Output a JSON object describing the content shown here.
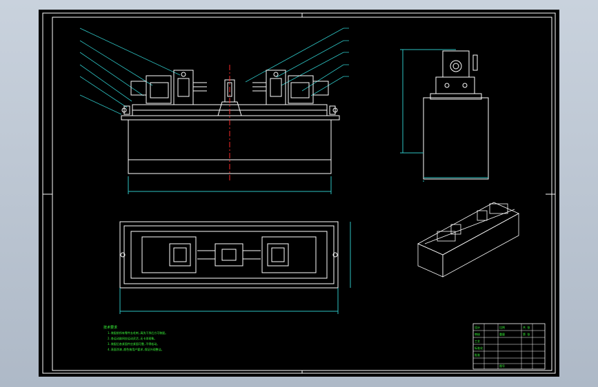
{
  "viewport": {
    "background": "#000000",
    "line_color": "#ffffff",
    "accent_color": "#2ec5c5",
    "center_line_color": "#ff2a2a",
    "text_color": "#3cff3c"
  },
  "technical_requirements": {
    "heading": "技术要求",
    "lines": [
      "1.装配前所有零件去毛刺,清洗干净后方可装配。",
      "2.各运动副间应运动灵活,无卡滞现象。",
      "3.装配后各紧固件应紧固可靠,不得松动。",
      "4.表面涂漆,颜色按用户要求,保证外观整洁。"
    ]
  },
  "title_block": {
    "cells": [
      "设计",
      "审核",
      "工艺",
      "标准化",
      "批准",
      "比例",
      "重量",
      "共 张",
      "第 张",
      "图号"
    ]
  }
}
